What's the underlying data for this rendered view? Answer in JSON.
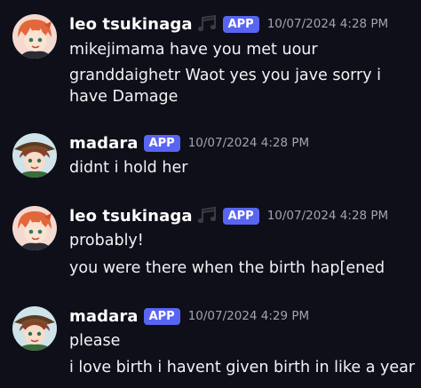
{
  "colors": {
    "background": "#0f0f1a",
    "app_badge": "#5865f2",
    "timestamp": "#a0a4ad",
    "text": "#f2f3f5"
  },
  "messages": [
    {
      "author": "leo tsukinaga",
      "author_icon": "music-notes-icon",
      "badge": "APP",
      "timestamp": "10/07/2024 4:28 PM",
      "lines": [
        "mikejimama have you met uour",
        "granddaighetr Waot yes you jave sorry i",
        "have Damage"
      ]
    },
    {
      "author": "madara",
      "badge": "APP",
      "timestamp": "10/07/2024 4:28 PM",
      "lines": [
        "didnt i hold her"
      ]
    },
    {
      "author": "leo tsukinaga",
      "author_icon": "music-notes-icon",
      "badge": "APP",
      "timestamp": "10/07/2024 4:28 PM",
      "lines": [
        "probably!",
        "you were there when the birth hap[ened"
      ]
    },
    {
      "author": "madara",
      "badge": "APP",
      "timestamp": "10/07/2024 4:29 PM",
      "lines": [
        "please",
        "i love birth i havent given birth in like a year"
      ]
    }
  ]
}
